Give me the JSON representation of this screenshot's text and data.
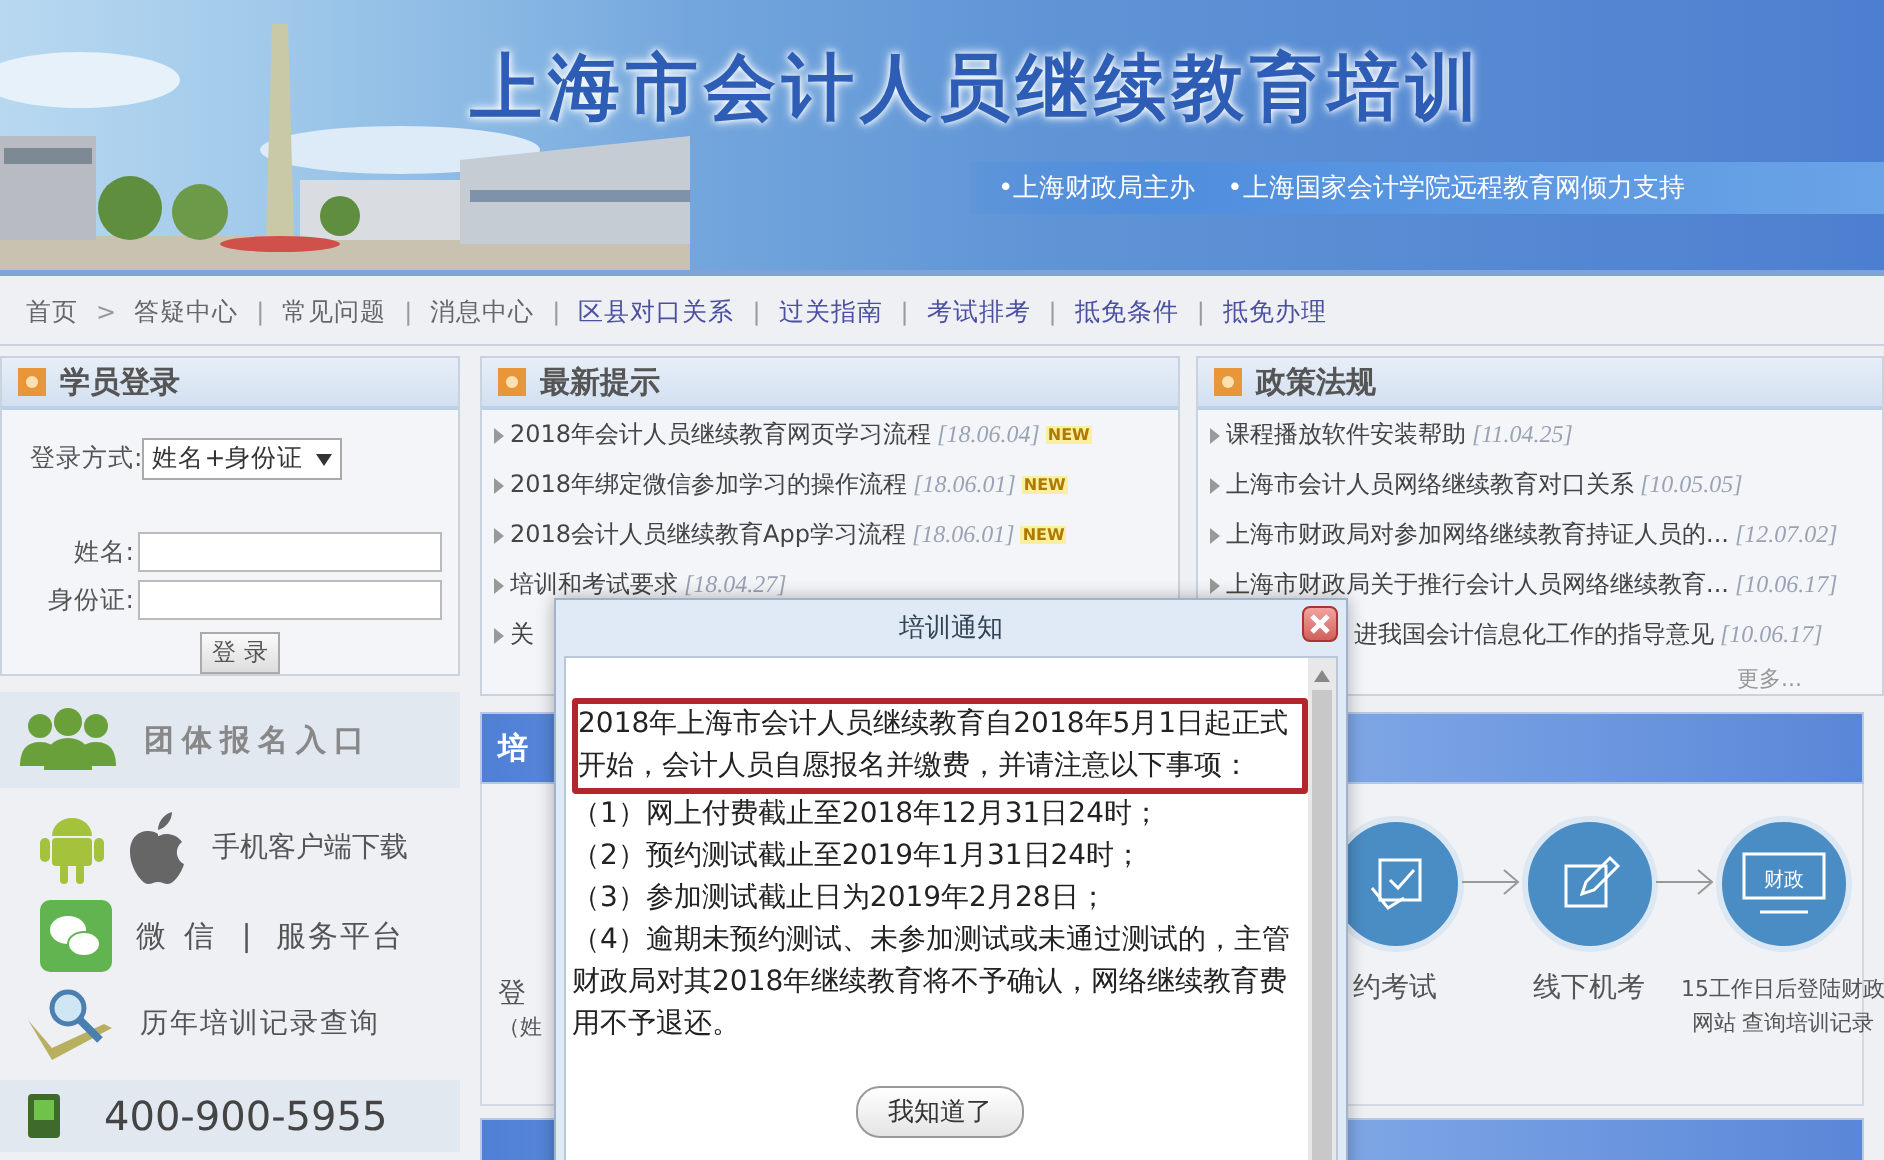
{
  "header": {
    "title": "上海市会计人员继续教育培训",
    "taglines": [
      "•上海财政局主办",
      "•上海国家会计学院远程教育网倾力支持"
    ]
  },
  "nav": [
    {
      "label": "首页",
      "visited": false
    },
    {
      "sep": ">",
      "label": "答疑中心",
      "visited": false
    },
    {
      "sep": "|",
      "label": "常见问题",
      "visited": false
    },
    {
      "sep": "|",
      "label": "消息中心",
      "visited": false
    },
    {
      "sep": "|",
      "label": "区县对口关系",
      "visited": true
    },
    {
      "sep": "|",
      "label": "过关指南",
      "visited": true
    },
    {
      "sep": "|",
      "label": "考试排考",
      "visited": true
    },
    {
      "sep": "|",
      "label": "抵免条件",
      "visited": true
    },
    {
      "sep": "|",
      "label": "抵免办理",
      "visited": true
    }
  ],
  "login": {
    "title": "学员登录",
    "method_label": "登录方式:",
    "method_value": "姓名+身份证",
    "fields": [
      {
        "label": "姓名:"
      },
      {
        "label": "身份证:"
      }
    ],
    "button": "登 录"
  },
  "news": {
    "title": "最新提示",
    "items": [
      {
        "text": "2018年会计人员继续教育网页学习流程",
        "date": "[18.06.04]",
        "badge": "NEW"
      },
      {
        "text": "2018年绑定微信参加学习的操作流程",
        "date": "[18.06.01]",
        "badge": "NEW"
      },
      {
        "text": "2018会计人员继续教育App学习流程",
        "date": "[18.06.01]",
        "badge": "NEW"
      },
      {
        "text": "培训和考试要求",
        "date": "[18.04.27]"
      },
      {
        "text": "关"
      }
    ]
  },
  "policy": {
    "title": "政策法规",
    "items": [
      {
        "text": "课程播放软件安装帮助",
        "date": "[11.04.25]",
        "kind": "full"
      },
      {
        "text": "上海市会计人员网络继续教育对口关系",
        "date": "[10.05.05]",
        "kind": "full"
      },
      {
        "text": "上海市财政局对参加网络继续教育持证人员的...",
        "date": "[12.07.02]",
        "kind": "full"
      },
      {
        "text": "上海市财政局关于推行会计人员网络继续教育...",
        "date": "[10.06.17]",
        "kind": "full"
      },
      {
        "text": "进我国会计信息化工作的指导意见",
        "date": "[10.06.17]",
        "kind": "covered"
      }
    ],
    "more": "更多..."
  },
  "links": {
    "group": "团体报名入口",
    "apps": "手机客户端下载",
    "wechat": [
      "微 信",
      "|",
      "服务平台"
    ],
    "history": "历年培训记录查询",
    "phone": "400-900-5955"
  },
  "process": {
    "title": "培",
    "steps": [
      {
        "kind": "cut",
        "lines": [
          "登",
          "（姓"
        ]
      },
      {
        "kind": "check",
        "lines": [
          "约考试"
        ]
      },
      {
        "kind": "edit",
        "lines": [
          "线下机考"
        ]
      },
      {
        "kind": "screen",
        "screen_text": "财政",
        "lines": [
          "15工作日后登陆财政",
          "网站 查询培训记录"
        ]
      }
    ]
  },
  "dialog": {
    "title": "培训通知",
    "notice": "2018年上海市会计人员继续教育自2018年5月1日起正式开始，会计人员自愿报名并缴费，并请注意以下事项：",
    "items": [
      "（1）网上付费截止至2018年12月31日24时；",
      "（2）预约测试截止至2019年1月31日24时；",
      "（3）参加测试截止日为2019年2月28日；",
      "（4）逾期未预约测试、未参加测试或未通过测试的，主管财政局对其2018年继续教育将不予确认，网络继续教育费用不予退还。"
    ],
    "button": "我知道了"
  }
}
